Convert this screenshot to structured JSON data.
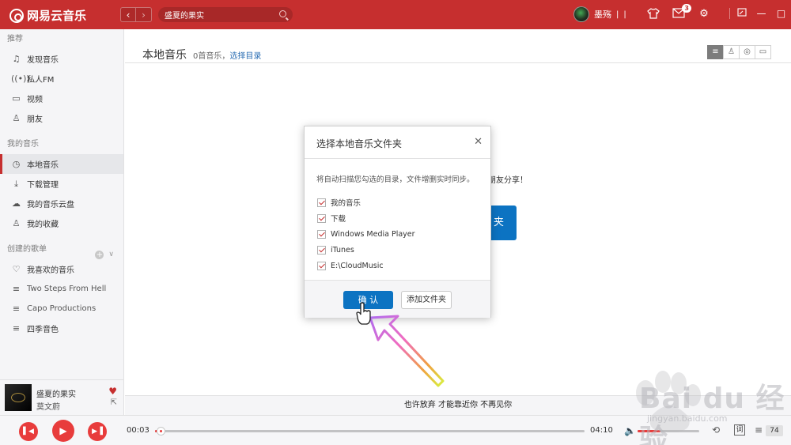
{
  "app": {
    "title": "网易云音乐",
    "search": {
      "value": "盛夏的果实"
    },
    "user": {
      "name": "墨殇"
    },
    "mail_badge": "3"
  },
  "sidebar": {
    "sections": [
      {
        "title": "推荐",
        "items": [
          {
            "label": "发现音乐",
            "icon": "music-note-icon"
          },
          {
            "label": "私人FM",
            "icon": "radio-icon"
          },
          {
            "label": "视频",
            "icon": "video-icon"
          },
          {
            "label": "朋友",
            "icon": "friends-icon"
          }
        ]
      },
      {
        "title": "我的音乐",
        "items": [
          {
            "label": "本地音乐",
            "icon": "local-music-icon",
            "active": true
          },
          {
            "label": "下载管理",
            "icon": "download-icon"
          },
          {
            "label": "我的音乐云盘",
            "icon": "cloud-icon"
          },
          {
            "label": "我的收藏",
            "icon": "favorites-icon"
          }
        ]
      },
      {
        "title": "创建的歌单",
        "items": [
          {
            "label": "我喜欢的音乐",
            "icon": "heart-icon"
          },
          {
            "label": "Two Steps From Hell",
            "icon": "playlist-icon"
          },
          {
            "label": "Capo Productions",
            "icon": "playlist-icon"
          },
          {
            "label": "四季音色",
            "icon": "playlist-icon"
          }
        ]
      }
    ]
  },
  "main": {
    "title": "本地音乐",
    "count": "0首音乐，",
    "choose_link": "选择目录",
    "bg_hint": "朋友分享！",
    "bg_button": "夹"
  },
  "dialog": {
    "title": "选择本地音乐文件夹",
    "description": "将自动扫描您勾选的目录，文件增删实时同步。",
    "folders": [
      "我的音乐",
      "下载",
      "Windows Media Player",
      "iTunes",
      "E:\\CloudMusic"
    ],
    "confirm": "确 认",
    "add_folder": "添加文件夹"
  },
  "now_playing": {
    "title": "盛夏的果实",
    "artist": "莫文蔚",
    "lyric": "也许放弃 才能靠近你 不再见你",
    "current_time": "00:03",
    "total_time": "04:10",
    "progress": 0.012,
    "volume": 0.37,
    "playlist_count": "74"
  },
  "watermark": {
    "text": "Bai du 经验",
    "url": "jingyan.baidu.com"
  },
  "colors": {
    "brand": "#c62f2f",
    "accent_blue": "#0c73c2",
    "link": "#2d6fb4"
  }
}
